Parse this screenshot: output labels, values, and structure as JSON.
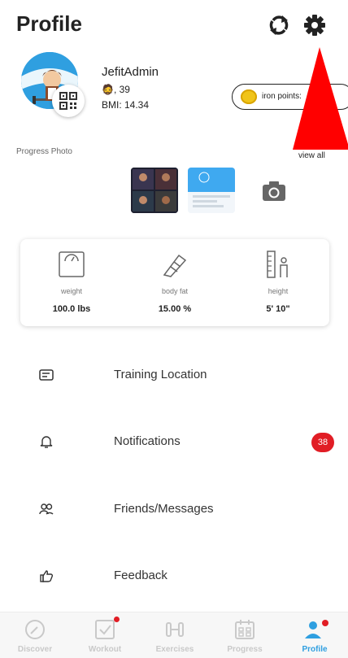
{
  "header": {
    "title": "Profile",
    "refresh_icon": "refresh-icon",
    "settings_icon": "gear-icon"
  },
  "user": {
    "username": "JefitAdmin",
    "age_text": ", 39",
    "bmi_text": "BMI:  14.34"
  },
  "iron_points": {
    "label": "iron points:"
  },
  "progress_photo": {
    "label": "Progress Photo",
    "view_all": "view all"
  },
  "stats": [
    {
      "label": "weight",
      "value": "100.0  lbs",
      "icon": "scale-icon"
    },
    {
      "label": "body fat",
      "value": "15.00 %",
      "icon": "caliper-icon"
    },
    {
      "label": "height",
      "value": "5' 10\"",
      "icon": "height-ruler-icon"
    }
  ],
  "menu": [
    {
      "label": "Training Location",
      "icon": "location-card-icon"
    },
    {
      "label": "Notifications",
      "icon": "bell-icon",
      "badge": "38"
    },
    {
      "label": "Friends/Messages",
      "icon": "friends-icon"
    },
    {
      "label": "Feedback",
      "icon": "thumbs-up-icon"
    }
  ],
  "tabs": [
    {
      "label": "Discover",
      "icon": "discover-icon",
      "active": false
    },
    {
      "label": "Workout",
      "icon": "workout-icon",
      "active": false,
      "dot": true
    },
    {
      "label": "Exercises",
      "icon": "dumbbell-icon",
      "active": false
    },
    {
      "label": "Progress",
      "icon": "calendar-icon",
      "active": false
    },
    {
      "label": "Profile",
      "icon": "profile-icon",
      "active": true,
      "dot": true
    }
  ],
  "colors": {
    "accent": "#2f9fe0",
    "badge": "#e11d25",
    "coin": "#f0c419",
    "annotation_arrow": "#ff0000"
  }
}
